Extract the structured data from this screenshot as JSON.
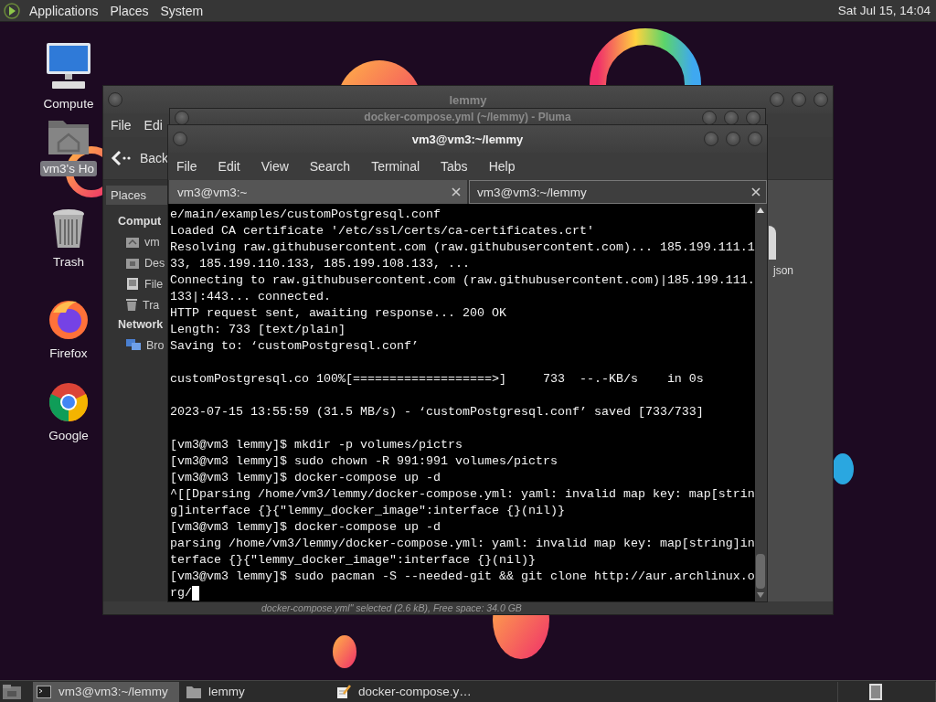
{
  "top_panel": {
    "menus": [
      "Applications",
      "Places",
      "System"
    ],
    "clock": "Sat Jul 15, 14:04"
  },
  "desktop_icons": [
    {
      "label": "Compute",
      "kind": "computer",
      "selected": false
    },
    {
      "label": "vm3's Ho",
      "kind": "home",
      "selected": true
    },
    {
      "label": "Trash",
      "kind": "trash",
      "selected": false
    },
    {
      "label": "Firefox",
      "kind": "firefox",
      "selected": false
    },
    {
      "label": "Google",
      "kind": "chrome",
      "selected": false
    }
  ],
  "file_manager": {
    "title": "lemmy",
    "menus": [
      "File",
      "Edi"
    ],
    "back_label": "Back",
    "sidebar_tab": "Places",
    "sidebar": [
      {
        "heading": "Comput",
        "items": [
          {
            "label": "vm",
            "kind": "home"
          },
          {
            "label": "Des",
            "kind": "desktop"
          },
          {
            "label": "File",
            "kind": "drive"
          },
          {
            "label": "Tra",
            "kind": "trash"
          }
        ]
      },
      {
        "heading": "Network",
        "items": [
          {
            "label": "Bro",
            "kind": "network"
          }
        ]
      }
    ],
    "file_label": "json",
    "status": "docker-compose.yml\" selected (2.6 kB), Free space: 34.0 GB"
  },
  "text_editor": {
    "title": "docker-compose.yml (~/lemmy) - Pluma"
  },
  "terminal": {
    "title": "vm3@vm3:~/lemmy",
    "menus": [
      "File",
      "Edit",
      "View",
      "Search",
      "Terminal",
      "Tabs",
      "Help"
    ],
    "tabs": [
      {
        "label": "vm3@vm3:~",
        "selected": false
      },
      {
        "label": "vm3@vm3:~/lemmy",
        "selected": true
      }
    ],
    "lines": [
      {
        "text": "e/main/examples/customPostgresql.conf"
      },
      {
        "text": "Loaded CA certificate '/etc/ssl/certs/ca-certificates.crt'"
      },
      {
        "text": "Resolving raw.githubusercontent.com (raw.githubusercontent.com)... 185.199.111.1"
      },
      {
        "text": "33, 185.199.110.133, 185.199.108.133, ..."
      },
      {
        "text": "Connecting to raw.githubusercontent.com (raw.githubusercontent.com)|185.199.111."
      },
      {
        "text": "133|:443... connected."
      },
      {
        "text": "HTTP request sent, awaiting response... 200 OK"
      },
      {
        "text": "Length: 733 [text/plain]"
      },
      {
        "text": "Saving to: ‘customPostgresql.conf’"
      },
      {
        "text": "customPostgresql.co 100%[===================>]     733  --.-KB/s    in 0s",
        "blank_before": true
      },
      {
        "text": "2023-07-15 13:55:59 (31.5 MB/s) - ‘customPostgresql.conf’ saved [733/733]",
        "blank_before": true
      },
      {
        "text": "[vm3@vm3 lemmy]$ mkdir -p volumes/pictrs",
        "blank_before": true
      },
      {
        "text": "[vm3@vm3 lemmy]$ sudo chown -R 991:991 volumes/pictrs"
      },
      {
        "text": "[vm3@vm3 lemmy]$ docker-compose up -d"
      },
      {
        "text": "^[[Dparsing /home/vm3/lemmy/docker-compose.yml: yaml: invalid map key: map[strin"
      },
      {
        "text": "g]interface {}{\"lemmy_docker_image\":interface {}(nil)}"
      },
      {
        "text": "[vm3@vm3 lemmy]$ docker-compose up -d"
      },
      {
        "text": "parsing /home/vm3/lemmy/docker-compose.yml: yaml: invalid map key: map[string]in"
      },
      {
        "text": "terface {}{\"lemmy_docker_image\":interface {}(nil)}"
      },
      {
        "text": "[vm3@vm3 lemmy]$ sudo pacman -S --needed-git && git clone http://aur.archlinux.o"
      },
      {
        "text": "rg/",
        "cursor": true
      }
    ]
  },
  "taskbar": {
    "tasks": [
      {
        "label": "vm3@vm3:~/lemmy",
        "kind": "terminal",
        "selected": true
      },
      {
        "label": "lemmy",
        "kind": "folder",
        "selected": false
      },
      {
        "label": "docker-compose.y…",
        "kind": "editor",
        "selected": false
      }
    ]
  }
}
